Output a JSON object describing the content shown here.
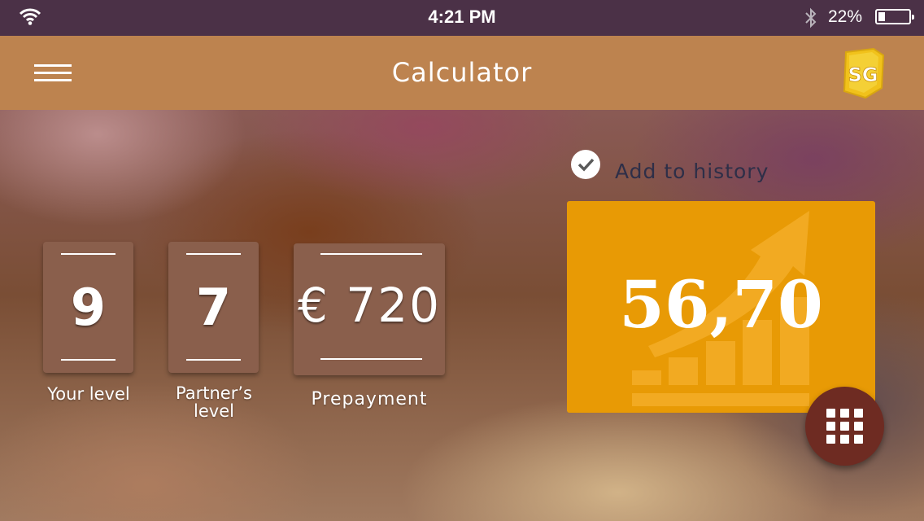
{
  "status_bar": {
    "time": "4:21 PM",
    "battery_percent": "22%",
    "battery_level": 0.22,
    "icons": [
      "wifi-icon",
      "bluetooth-icon",
      "battery-icon"
    ]
  },
  "app_bar": {
    "title": "Calculator",
    "menu_icon": "hamburger-menu-icon",
    "logo_text": "SG",
    "logo_color": "#f1c21b"
  },
  "inputs": [
    {
      "value": "9",
      "label": "Your level"
    },
    {
      "value": "7",
      "label": "Partner's level",
      "label_lines": [
        "Partner’s",
        "level"
      ]
    },
    {
      "value": "€ 720",
      "label": "Prepayment"
    }
  ],
  "history": {
    "label": "Add to history",
    "checked": true
  },
  "result": {
    "value": "56,70"
  },
  "colors": {
    "status_bar": "#4b3147",
    "app_bar": "#bd834f",
    "card": "#8a5f4c",
    "result": "#e89a05",
    "fab": "#6e2b22",
    "history_text": "#2e2f48"
  },
  "fab": {
    "icon": "keypad-grid-icon"
  }
}
